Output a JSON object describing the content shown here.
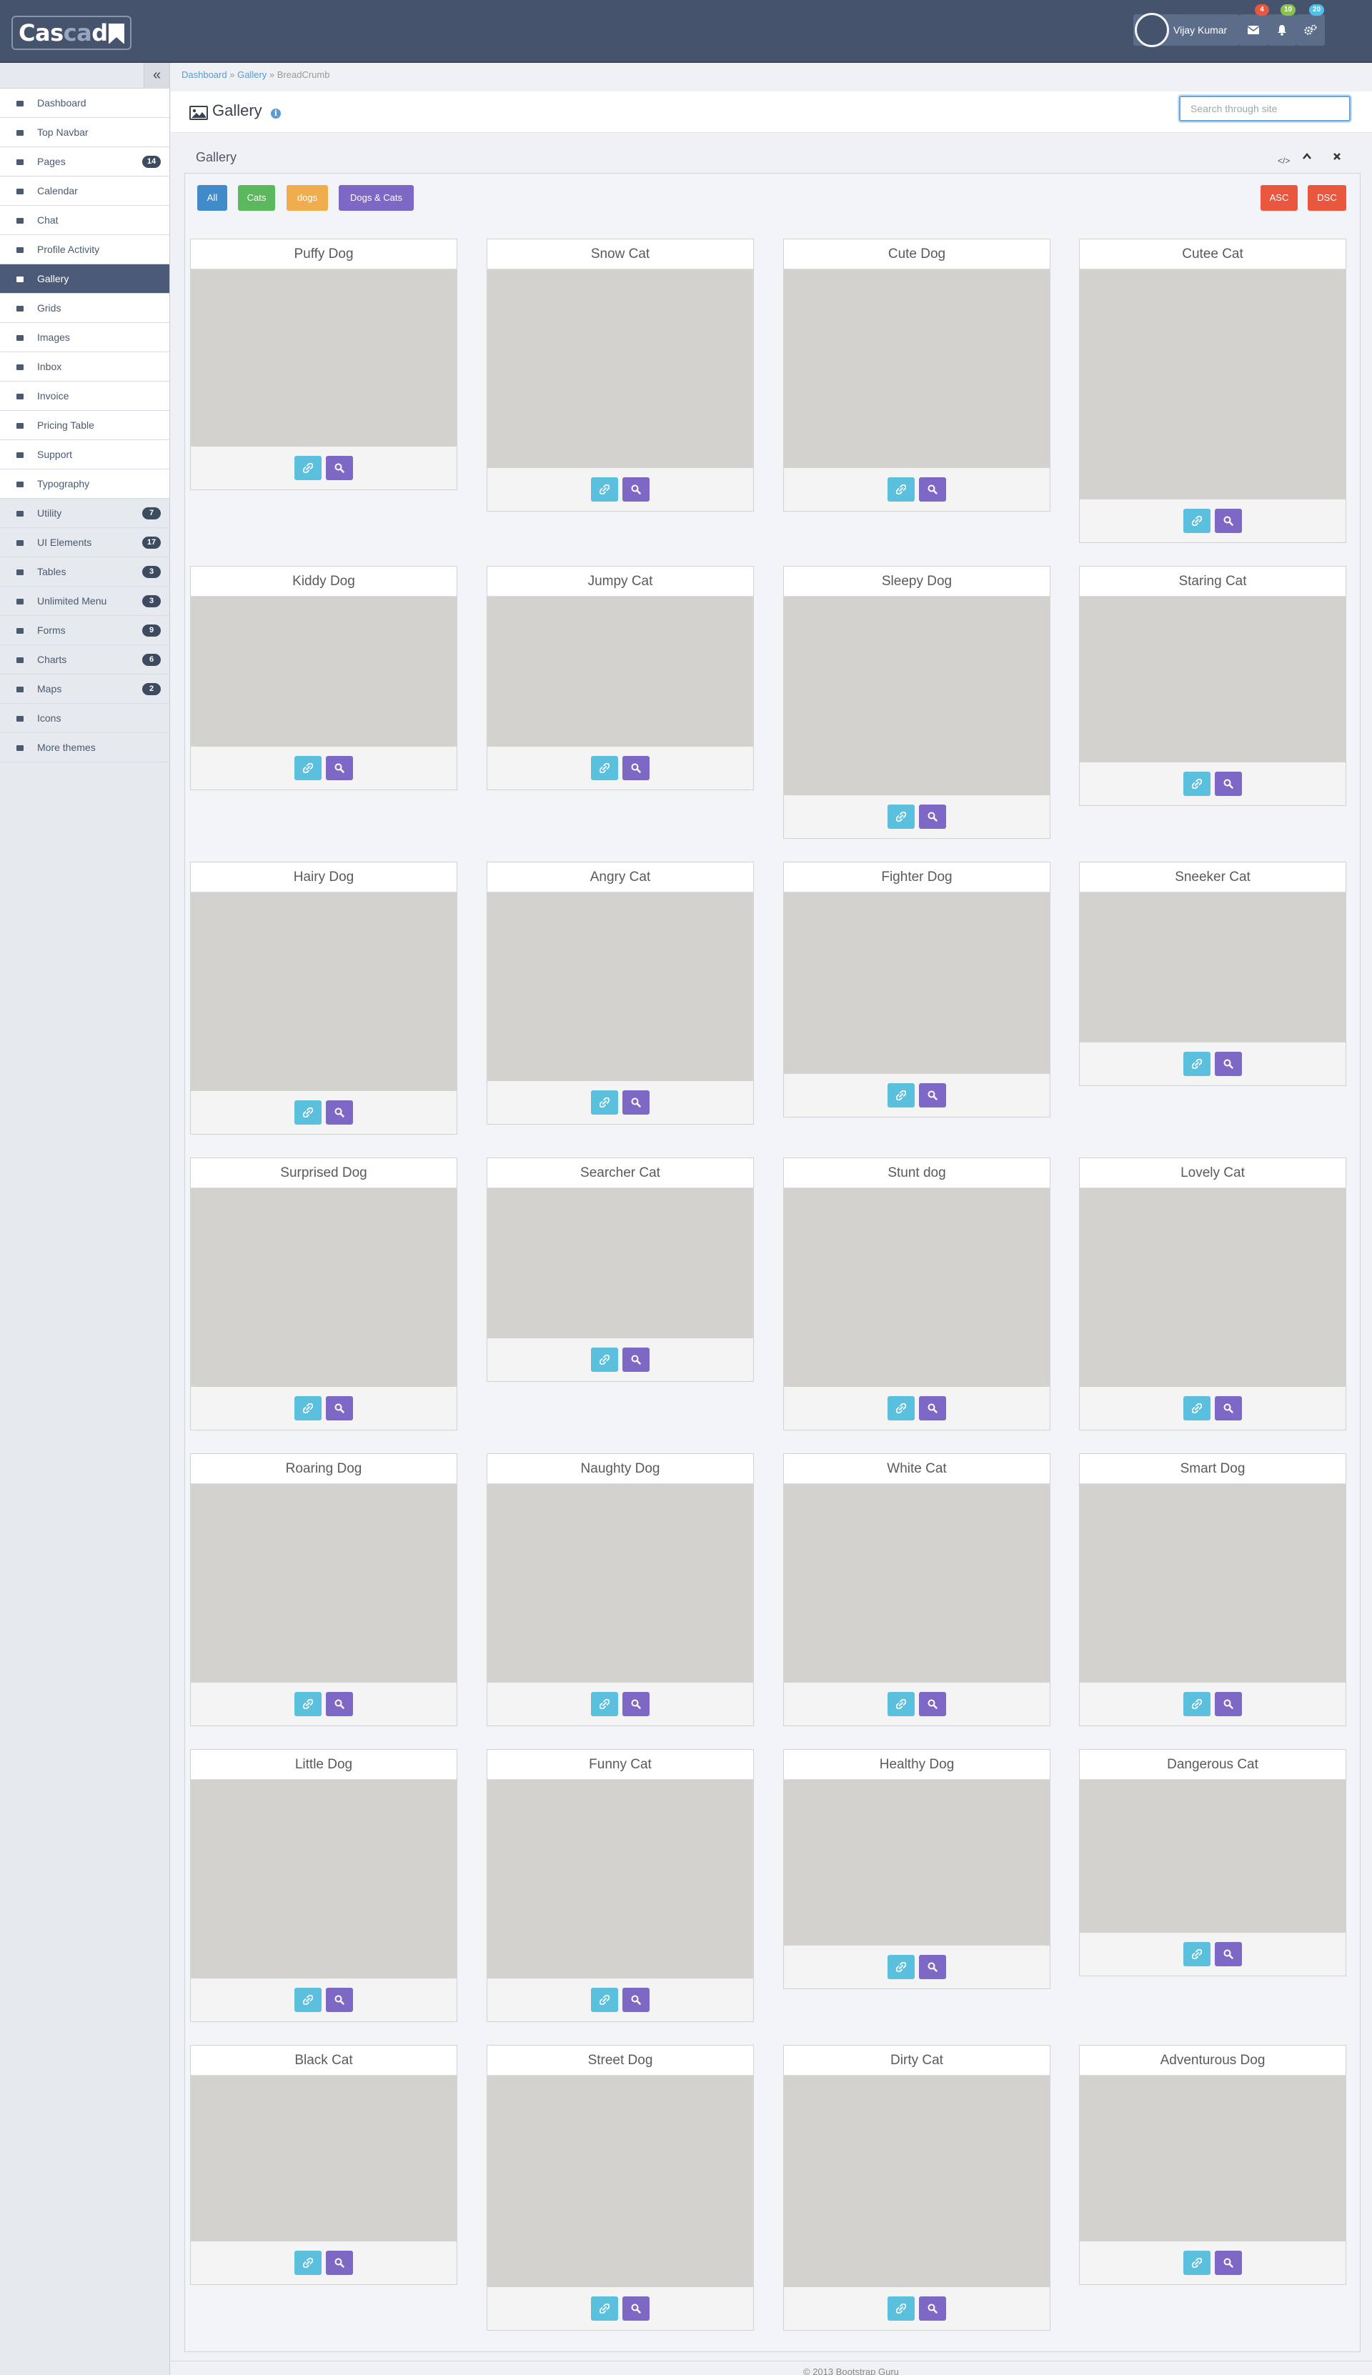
{
  "app": {
    "logo_a": "Cas",
    "logo_b": "ca",
    "logo_c": "de"
  },
  "header": {
    "user_name": "Vijay Kumar",
    "badges": [
      "4",
      "10",
      "20"
    ]
  },
  "sidebar": {
    "items": [
      {
        "label": "Dashboard",
        "badge": "",
        "icon": "dashboard-icon"
      },
      {
        "label": "Top Navbar",
        "badge": "",
        "icon": "top-navbar-icon"
      },
      {
        "label": "Pages",
        "badge": "14",
        "icon": "pages-icon"
      },
      {
        "label": "Calendar",
        "badge": "",
        "icon": "calendar-icon"
      },
      {
        "label": "Chat",
        "badge": "",
        "icon": "chat-icon"
      },
      {
        "label": "Profile Activity",
        "badge": "",
        "icon": "activity-icon"
      },
      {
        "label": "Gallery",
        "badge": "",
        "icon": "gallery-icon"
      },
      {
        "label": "Grids",
        "badge": "",
        "icon": "grid-icon"
      },
      {
        "label": "Images",
        "badge": "",
        "icon": "image-icon"
      },
      {
        "label": "Inbox",
        "badge": "",
        "icon": "inbox-icon"
      },
      {
        "label": "Invoice",
        "badge": "",
        "icon": "invoice-icon"
      },
      {
        "label": "Pricing Table",
        "badge": "",
        "icon": "pricing-icon"
      },
      {
        "label": "Support",
        "badge": "",
        "icon": "support-icon"
      },
      {
        "label": "Typography",
        "badge": "",
        "icon": "typography-icon"
      },
      {
        "label": "Utility",
        "badge": "7",
        "icon": "utility-icon"
      },
      {
        "label": "UI Elements",
        "badge": "17",
        "icon": "ui-elements-icon"
      },
      {
        "label": "Tables",
        "badge": "3",
        "icon": "tables-icon"
      },
      {
        "label": "Unlimited Menu",
        "badge": "3",
        "icon": "menu-icon"
      },
      {
        "label": "Forms",
        "badge": "9",
        "icon": "forms-icon"
      },
      {
        "label": "Charts",
        "badge": "6",
        "icon": "charts-icon"
      },
      {
        "label": "Maps",
        "badge": "2",
        "icon": "map-icon"
      },
      {
        "label": "Icons",
        "badge": "",
        "icon": "icons-icon"
      },
      {
        "label": "More themes",
        "badge": "",
        "icon": "themes-icon"
      }
    ]
  },
  "breadcrumb": {
    "items": [
      "Dashboard",
      "Gallery"
    ],
    "current": "BreadCrumb",
    "separator": "»"
  },
  "page": {
    "title": "Gallery",
    "search_placeholder": "Search through site"
  },
  "panel": {
    "title": "Gallery",
    "filters": [
      "All",
      "Cats",
      "dogs",
      "Dogs & Cats"
    ],
    "sort": [
      "ASC",
      "DSC"
    ]
  },
  "gallery": {
    "cards": [
      {
        "title": "Puffy Dog"
      },
      {
        "title": "Snow Cat"
      },
      {
        "title": "Cute Dog"
      },
      {
        "title": "Cutee Cat"
      },
      {
        "title": "Kiddy Dog"
      },
      {
        "title": "Jumpy Cat"
      },
      {
        "title": "Sleepy Dog"
      },
      {
        "title": "Staring Cat"
      },
      {
        "title": "Hairy Dog"
      },
      {
        "title": "Angry Cat"
      },
      {
        "title": "Fighter Dog"
      },
      {
        "title": "Sneeker Cat"
      },
      {
        "title": "Surprised Dog"
      },
      {
        "title": "Searcher Cat"
      },
      {
        "title": "Stunt dog"
      },
      {
        "title": "Lovely Cat"
      },
      {
        "title": "Roaring Dog"
      },
      {
        "title": "Naughty Dog"
      },
      {
        "title": "White Cat"
      },
      {
        "title": "Smart Dog"
      },
      {
        "title": "Little Dog"
      },
      {
        "title": "Funny Cat"
      },
      {
        "title": "Healthy Dog"
      },
      {
        "title": "Dangerous Cat"
      },
      {
        "title": "Black Cat"
      },
      {
        "title": "Street Dog"
      },
      {
        "title": "Dirty Cat"
      },
      {
        "title": "Adventurous Dog"
      }
    ]
  },
  "footer": {
    "copyright": "© 2013 Bootstrap Guru"
  },
  "colors": {
    "navbar": "#45536d",
    "filter_all": "#428bca",
    "filter_cats": "#5cb85c",
    "filter_dogs": "#f0ad4e",
    "filter_dogs_cats": "#7e68c5",
    "sort": "#e9573f",
    "link_button": "#5bc0de",
    "zoom_button": "#7e68c5"
  }
}
